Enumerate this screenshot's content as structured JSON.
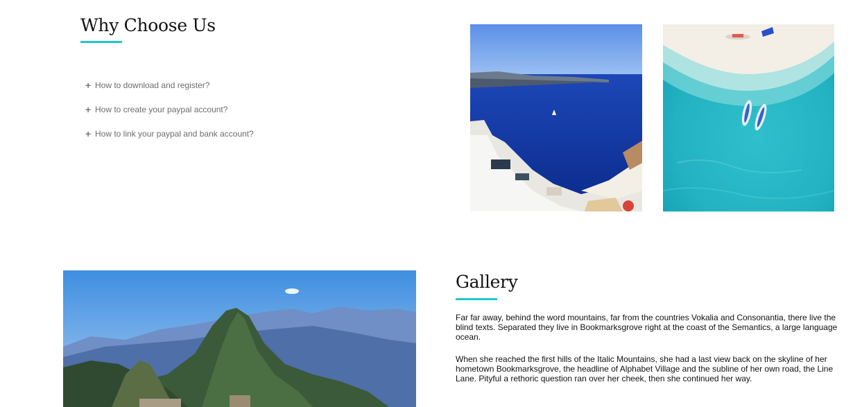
{
  "why_section": {
    "title": "Why Choose Us",
    "faqs": [
      {
        "icon": "plus-icon",
        "label": "How to download and register?"
      },
      {
        "icon": "plus-icon",
        "label": "How to create your paypal account?"
      },
      {
        "icon": "plus-icon",
        "label": "How to link your paypal and bank account?"
      }
    ]
  },
  "images": {
    "santorini": "santorini-photo",
    "beach": "beach-photo",
    "mountain": "mountain-photo"
  },
  "gallery_section": {
    "title": "Gallery",
    "paragraphs": [
      "Far far away, behind the word mountains, far from the countries Vokalia and Consonantia, there live the blind texts. Separated they live in Bookmarksgrove right at the coast of the Semantics, a large language ocean.",
      "When she reached the first hills of the Italic Mountains, she had a last view back on the skyline of her hometown Bookmarksgrove, the headline of Alphabet Village and the subline of her own road, the Line Lane. Pityful a rethoric question ran over her cheek, then she continued her way."
    ]
  },
  "colors": {
    "accent": "#1ec7d0",
    "heading": "#111111",
    "faq_text": "#6c6c6c"
  }
}
